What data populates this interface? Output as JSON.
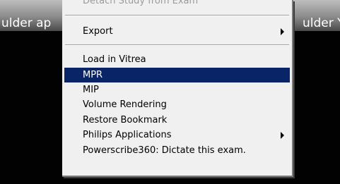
{
  "background": {
    "left_series_label": "ulder ap",
    "right_series_label": "ulder Y"
  },
  "context_menu": {
    "items": [
      {
        "label": "Detach Study from Exam",
        "state": "disabled-partially-visible"
      },
      {
        "label": "Export",
        "submenu": true
      },
      {
        "label": "Load in Vitrea"
      },
      {
        "label": "MPR",
        "state": "highlighted"
      },
      {
        "label": "MIP"
      },
      {
        "label": "Volume Rendering"
      },
      {
        "label": "Restore Bookmark"
      },
      {
        "label": "Philips Applications",
        "submenu": true
      },
      {
        "label": "Powerscribe360: Dictate this exam."
      }
    ]
  },
  "colors": {
    "highlight": "#0a2468",
    "menu_background": "#f0f0f0",
    "viewer_background": "#000000"
  }
}
